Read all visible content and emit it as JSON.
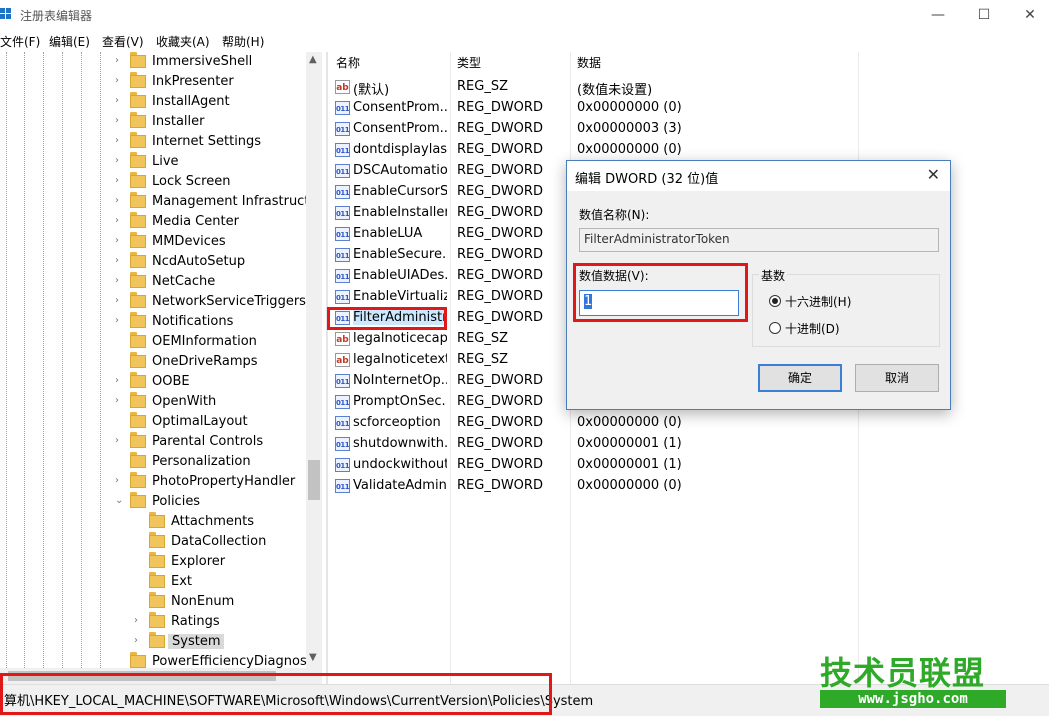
{
  "window": {
    "title": "注册表编辑器",
    "minimize": "—",
    "maximize": "☐",
    "close": "✕"
  },
  "menu": [
    "文件(F)",
    "编辑(E)",
    "查看(V)",
    "收藏夹(A)",
    "帮助(H)"
  ],
  "tree": {
    "items": [
      {
        "label": "ImmersiveShell",
        "expander": ">"
      },
      {
        "label": "InkPresenter",
        "expander": ">"
      },
      {
        "label": "InstallAgent",
        "expander": ">"
      },
      {
        "label": "Installer",
        "expander": ">"
      },
      {
        "label": "Internet Settings",
        "expander": ">"
      },
      {
        "label": "Live",
        "expander": ">"
      },
      {
        "label": "Lock Screen",
        "expander": ">"
      },
      {
        "label": "Management Infrastructure",
        "expander": ">"
      },
      {
        "label": "Media Center",
        "expander": ">"
      },
      {
        "label": "MMDevices",
        "expander": ">"
      },
      {
        "label": "NcdAutoSetup",
        "expander": ">"
      },
      {
        "label": "NetCache",
        "expander": ">"
      },
      {
        "label": "NetworkServiceTriggers",
        "expander": ">"
      },
      {
        "label": "Notifications",
        "expander": ">"
      },
      {
        "label": "OEMInformation",
        "expander": ""
      },
      {
        "label": "OneDriveRamps",
        "expander": ""
      },
      {
        "label": "OOBE",
        "expander": ">"
      },
      {
        "label": "OpenWith",
        "expander": ">"
      },
      {
        "label": "OptimalLayout",
        "expander": ""
      },
      {
        "label": "Parental Controls",
        "expander": ">"
      },
      {
        "label": "Personalization",
        "expander": ""
      },
      {
        "label": "PhotoPropertyHandler",
        "expander": ">"
      },
      {
        "label": "Policies",
        "expander": "v"
      },
      {
        "label": "Attachments",
        "expander": ""
      },
      {
        "label": "DataCollection",
        "expander": ""
      },
      {
        "label": "Explorer",
        "expander": ""
      },
      {
        "label": "Ext",
        "expander": ""
      },
      {
        "label": "NonEnum",
        "expander": ""
      },
      {
        "label": "Ratings",
        "expander": ">"
      },
      {
        "label": "System",
        "expander": ">",
        "selected": true
      },
      {
        "label": "PowerEfficiencyDiagnostics",
        "expander": ""
      }
    ]
  },
  "list": {
    "headers": {
      "name": "名称",
      "type": "类型",
      "data": "数据"
    },
    "rows": [
      {
        "icon": "ab",
        "kind": "sz",
        "name": "(默认)",
        "type": "REG_SZ",
        "data": "(数值未设置)"
      },
      {
        "icon": "011\n110",
        "kind": "dw",
        "name": "ConsentProm...",
        "type": "REG_DWORD",
        "data": "0x00000000 (0)"
      },
      {
        "icon": "011\n110",
        "kind": "dw",
        "name": "ConsentProm...",
        "type": "REG_DWORD",
        "data": "0x00000003 (3)"
      },
      {
        "icon": "011\n110",
        "kind": "dw",
        "name": "dontdisplaylas...",
        "type": "REG_DWORD",
        "data": "0x00000000 (0)"
      },
      {
        "icon": "011\n110",
        "kind": "dw",
        "name": "DSCAutomatio...",
        "type": "REG_DWORD",
        "data": ""
      },
      {
        "icon": "011\n110",
        "kind": "dw",
        "name": "EnableCursorS...",
        "type": "REG_DWORD",
        "data": ""
      },
      {
        "icon": "011\n110",
        "kind": "dw",
        "name": "EnableInstaller...",
        "type": "REG_DWORD",
        "data": ""
      },
      {
        "icon": "011\n110",
        "kind": "dw",
        "name": "EnableLUA",
        "type": "REG_DWORD",
        "data": ""
      },
      {
        "icon": "011\n110",
        "kind": "dw",
        "name": "EnableSecure...",
        "type": "REG_DWORD",
        "data": ""
      },
      {
        "icon": "011\n110",
        "kind": "dw",
        "name": "EnableUIADes...",
        "type": "REG_DWORD",
        "data": ""
      },
      {
        "icon": "011\n110",
        "kind": "dw",
        "name": "EnableVirtualiz...",
        "type": "REG_DWORD",
        "data": ""
      },
      {
        "icon": "011\n110",
        "kind": "dw",
        "name": "FilterAdministr...",
        "type": "REG_DWORD",
        "data": "",
        "selected": true
      },
      {
        "icon": "ab",
        "kind": "sz",
        "name": "legalnoticecap...",
        "type": "REG_SZ",
        "data": ""
      },
      {
        "icon": "ab",
        "kind": "sz",
        "name": "legalnoticetext",
        "type": "REG_SZ",
        "data": ""
      },
      {
        "icon": "011\n110",
        "kind": "dw",
        "name": "NoInternetOp...",
        "type": "REG_DWORD",
        "data": ""
      },
      {
        "icon": "011\n110",
        "kind": "dw",
        "name": "PromptOnSec...",
        "type": "REG_DWORD",
        "data": ""
      },
      {
        "icon": "011\n110",
        "kind": "dw",
        "name": "scforceoption",
        "type": "REG_DWORD",
        "data": "0x00000000 (0)"
      },
      {
        "icon": "011\n110",
        "kind": "dw",
        "name": "shutdownwith...",
        "type": "REG_DWORD",
        "data": "0x00000001 (1)"
      },
      {
        "icon": "011\n110",
        "kind": "dw",
        "name": "undockwithout...",
        "type": "REG_DWORD",
        "data": "0x00000001 (1)"
      },
      {
        "icon": "011\n110",
        "kind": "dw",
        "name": "ValidateAdmin...",
        "type": "REG_DWORD",
        "data": "0x00000000 (0)"
      }
    ]
  },
  "status": {
    "path": "算机\\HKEY_LOCAL_MACHINE\\SOFTWARE\\Microsoft\\Windows\\CurrentVersion\\Policies\\System"
  },
  "dialog": {
    "title": "编辑 DWORD (32 位)值",
    "close": "✕",
    "name_label": "数值名称(N):",
    "name_value": "FilterAdministratorToken",
    "data_label": "数值数据(V):",
    "data_value": "1",
    "base_label": "基数",
    "hex_label": "十六进制(H)",
    "dec_label": "十进制(D)",
    "ok_label": "确定",
    "cancel_label": "取消"
  },
  "watermark": {
    "top": "技术员联盟",
    "bottom": "www.jsgho.com"
  },
  "colors": {
    "highlight": "#e01818",
    "selection": "#cce8ff",
    "watermark": "#2ea928"
  }
}
